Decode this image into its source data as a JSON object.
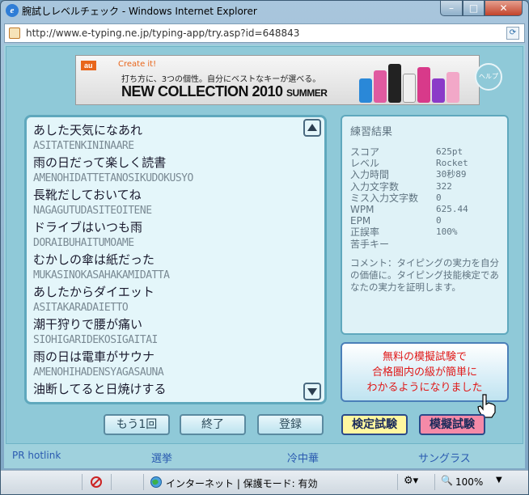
{
  "window": {
    "title": "腕試しレベルチェック - Windows Internet Explorer",
    "url": "http://www.e-typing.ne.jp/typing-app/try.asp?id=648843",
    "min": "–",
    "max": "□",
    "close": "✕",
    "refresh": "⟳"
  },
  "banner": {
    "logo": "au",
    "create": "Create it!",
    "sub": "打ち方に、3つの個性。自分にベストなキーが選べる。",
    "big": "NEW COLLECTION 2010",
    "big_small": "SUMMER"
  },
  "help": "ヘルプ",
  "lines": [
    {
      "ja": "あした天気になあれ",
      "ro": "ASITATENKININAARE"
    },
    {
      "ja": "雨の日だって楽しく読書",
      "ro": "AMENOHIDATTETANOSIKUDOKUSYO"
    },
    {
      "ja": "長靴だしておいてね",
      "ro": "NAGAGUTUDASITEOITENE"
    },
    {
      "ja": "ドライブはいつも雨",
      "ro": "DORAIBUHAITUMOAME"
    },
    {
      "ja": "むかしの傘は紙だった",
      "ro": "MUKASINOKASAHAKAMIDATTA"
    },
    {
      "ja": "あしたからダイエット",
      "ro": "ASITAKARADAIETTO"
    },
    {
      "ja": "潮干狩りで腰が痛い",
      "ro": "SIOHIGARIDEKOSIGAITAI"
    },
    {
      "ja": "雨の日は電車がサウナ",
      "ro": "AMENOHIHADENSYAGASAUNA"
    },
    {
      "ja": "油断してると日焼けする",
      "ro": ""
    }
  ],
  "result": {
    "heading": "練習結果",
    "rows": [
      {
        "k": "スコア",
        "v": "625pt"
      },
      {
        "k": "レベル",
        "v": "Rocket"
      },
      {
        "k": "入力時間",
        "v": "30秒89"
      },
      {
        "k": "入力文字数",
        "v": "322"
      },
      {
        "k": "ミス入力文字数",
        "v": "0"
      },
      {
        "k": "WPM",
        "v": "625.44"
      },
      {
        "k": "EPM",
        "v": "0"
      },
      {
        "k": "正誤率",
        "v": "100%"
      },
      {
        "k": "苦手キー",
        "v": ""
      }
    ],
    "comment": "コメント：タイピングの実力を自分の価値に。タイピング技能検定であなたの実力を証明します。"
  },
  "mock": {
    "l1": "無料の模擬試験で",
    "l2": "合格圏内の級が簡単に",
    "l3": "わかるようになりました"
  },
  "buttons": {
    "again": "もう1回",
    "end": "終了",
    "register": "登録",
    "kentei": "検定試験",
    "mogi": "模擬試験"
  },
  "pr": {
    "label": "PR hotlink",
    "l1": "選挙",
    "l2": "冷中華",
    "l3": "サングラス"
  },
  "status": {
    "zone": "インターネット | 保護モード: 有効",
    "zoom": "100%"
  }
}
